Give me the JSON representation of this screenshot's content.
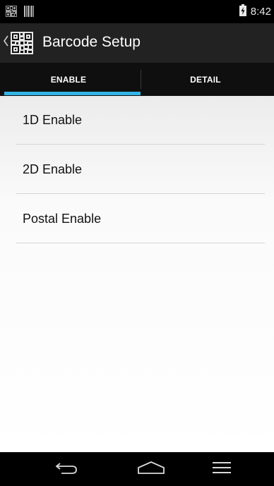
{
  "status_bar": {
    "time": "8:42",
    "icons": [
      "barcode-notification-icon",
      "scanner-notification-icon",
      "battery-charging-icon"
    ]
  },
  "action_bar": {
    "title": "Barcode Setup",
    "icon": "barcode-app-icon"
  },
  "tabs": [
    {
      "label": "ENABLE",
      "selected": true
    },
    {
      "label": "DETAIL",
      "selected": false
    }
  ],
  "list_items": [
    {
      "label": "1D Enable"
    },
    {
      "label": "2D Enable"
    },
    {
      "label": "Postal Enable"
    }
  ],
  "nav_bar": {
    "buttons": [
      "back-icon",
      "home-icon",
      "menu-icon"
    ]
  },
  "colors": {
    "status_bar": "#000000",
    "action_bar": "#222222",
    "tab_bar": "#0f0f0f",
    "accent": "#33b5e5"
  }
}
